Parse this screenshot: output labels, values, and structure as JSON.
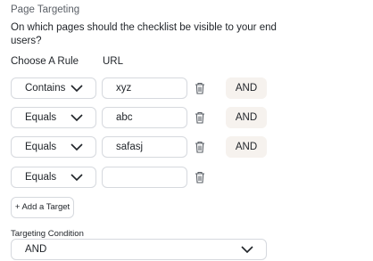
{
  "section_title": "Page Targeting",
  "question": "On which pages should the checklist be visible to your end users?",
  "columns": {
    "rule": "Choose A Rule",
    "url": "URL"
  },
  "rules": [
    {
      "rule": "Contains",
      "url": "xyz",
      "connector": "AND"
    },
    {
      "rule": "Equals",
      "url": "abc",
      "connector": "AND"
    },
    {
      "rule": "Equals",
      "url": "safasj",
      "connector": "AND"
    },
    {
      "rule": "Equals",
      "url": "",
      "connector": ""
    }
  ],
  "add_target_label": "+ Add a Target",
  "targeting_condition": {
    "label": "Targeting Condition",
    "value": "AND"
  },
  "icons": {
    "select_arrow": "chevron-down-icon",
    "delete": "trash-icon"
  },
  "colors": {
    "and_button_bg": "#f6f2ee",
    "border": "#d6d9de"
  }
}
